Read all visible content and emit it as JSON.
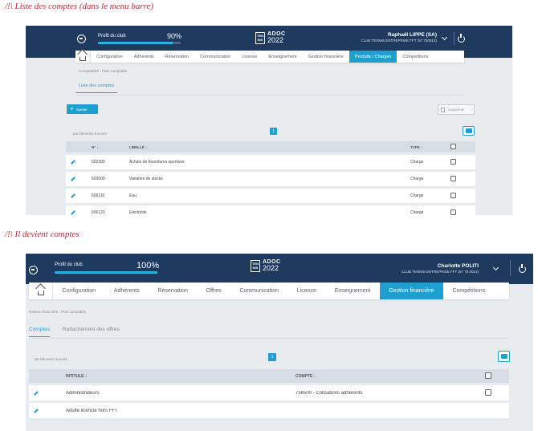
{
  "captions": {
    "first": "/!\\  Liste des comptes (dans le menu barre)",
    "second": "/!\\  Il devient comptes"
  },
  "colors": {
    "header_bg": "#1e3a5f",
    "accent": "#1f9fd0",
    "caption": "#b4302f",
    "page_bg": "#e9ecef"
  },
  "logo": {
    "box_top": "TEN",
    "box_bottom": "NIS",
    "name": "ADOC",
    "year": "2022"
  },
  "before": {
    "header": {
      "profile_label": "Profil du club",
      "profile_pct": "90%",
      "profile_fill": 0.9,
      "user_name": "Raphaël LIPPE (SA)",
      "club": "CLUB TENNIS ENTREPRISE FFT (57 750013)"
    },
    "menu": [
      "Configuration",
      "Adhérents",
      "Réservation",
      "Communication",
      "Licence",
      "Enseignement",
      "Gestion financière",
      "Produits / Charges",
      "Compétitions"
    ],
    "active_menu_index": 7,
    "breadcrumb": "Comptabilité  ›  Plan comptable",
    "tabs": [
      "Liste des comptes"
    ],
    "add_button": "Ajouter",
    "delete_button": "Supprimer",
    "count": "116 éléments trouvés",
    "page": "1",
    "columns": {
      "num": "N° ↓",
      "label": "LIBELLÉ ↓",
      "type": "TYPE ↓"
    },
    "rows": [
      {
        "num": "602300",
        "label": "Achats de fournitures sportives",
        "type": "Charge"
      },
      {
        "num": "603000",
        "label": "Variation de stocks",
        "type": "Charge"
      },
      {
        "num": "606110",
        "label": "Eau",
        "type": "Charge"
      },
      {
        "num": "606120",
        "label": "Electricité",
        "type": "Charge"
      }
    ]
  },
  "after": {
    "header": {
      "profile_label": "Profil du club",
      "profile_pct": "100%",
      "profile_fill": 1.0,
      "user_name": "Charlotte POLITI",
      "club": "CLUB TENNIS ENTREPRISE FFT (57 75 0013)"
    },
    "menu": [
      "Configuration",
      "Adhérents",
      "Réservation",
      "Offres",
      "Communication",
      "Licence",
      "Enseignement",
      "Gestion financière",
      "Compétitions"
    ],
    "active_menu_index": 7,
    "breadcrumb": "Gestion financière  ›  Plan comptable",
    "tabs": [
      "Comptes",
      "Rattachement des offres"
    ],
    "count": "55 éléments trouvés",
    "page": "1",
    "columns": {
      "label": "INTITULÉ ↓",
      "account": "COMPTE ↓"
    },
    "rows": [
      {
        "label": "Administrateurs",
        "account": "756500 - Cotisations adhérents"
      },
      {
        "label": "Adulte licencié hors FFT",
        "account": ""
      }
    ]
  }
}
